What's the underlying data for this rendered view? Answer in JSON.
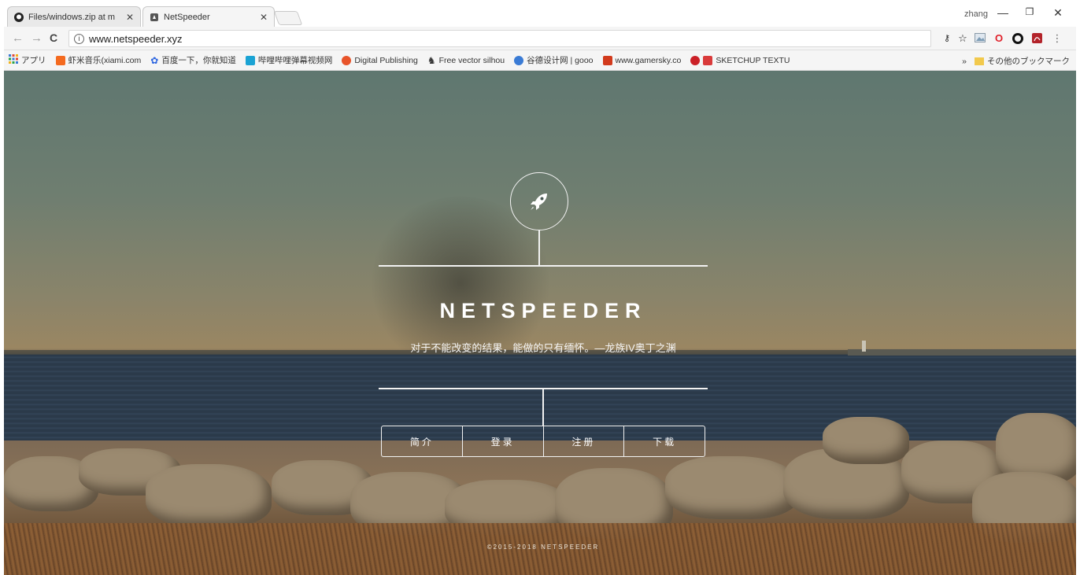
{
  "browser": {
    "tabs": [
      {
        "title": "Files/windows.zip at m",
        "icon": "github-icon",
        "active": false
      },
      {
        "title": "NetSpeeder",
        "icon": "site-favicon",
        "active": true
      }
    ],
    "profile_name": "zhang",
    "window_controls": {
      "minimize": "—",
      "restore": "❐",
      "close": "✕"
    },
    "nav": {
      "back": "←",
      "forward": "→",
      "reload": "C"
    },
    "address": "www.netspeeder.xyz",
    "bookmarks": [
      {
        "label": "アプリ",
        "icon": "apps-grid-icon"
      },
      {
        "label": "虾米音乐(xiami.com",
        "icon": "xiami-icon",
        "color": "#f46a1f"
      },
      {
        "label": "百度一下，你就知道",
        "icon": "baidu-paw-icon",
        "color": "#2b64e0"
      },
      {
        "label": "哔哩哔哩弹幕视频网",
        "icon": "bilibili-icon",
        "color": "#1aa3d4"
      },
      {
        "label": "Digital Publishing",
        "icon": "digital-publishing-icon",
        "color": "#e8542a"
      },
      {
        "label": "Free vector silhou",
        "icon": "vector-silhouette-icon",
        "color": "#333333"
      },
      {
        "label": "谷德设计网 | gooo",
        "icon": "gooood-icon",
        "color": "#3a7bd5"
      },
      {
        "label": "www.gamersky.co",
        "icon": "gamersky-icon",
        "color": "#d23a1c"
      },
      {
        "label": "SKETCHUP TEXTU",
        "icon": "sketchup-icon",
        "color": "#d93a3a"
      }
    ],
    "bookmarks_overflow": "»",
    "other_bookmarks": "その他のブックマーク"
  },
  "hero": {
    "brand": "NETSPEEDER",
    "tagline": "对于不能改变的结果，能做的只有缅怀。—龙族IV奥丁之渊",
    "nav": [
      {
        "label": "简介"
      },
      {
        "label": "登录"
      },
      {
        "label": "注册"
      },
      {
        "label": "下载"
      }
    ],
    "footer": "©2015-2018 NETSPEEDER"
  },
  "colors": {
    "hero_line": "#f2f2f2",
    "chrome_bg": "#f5f5f5"
  }
}
